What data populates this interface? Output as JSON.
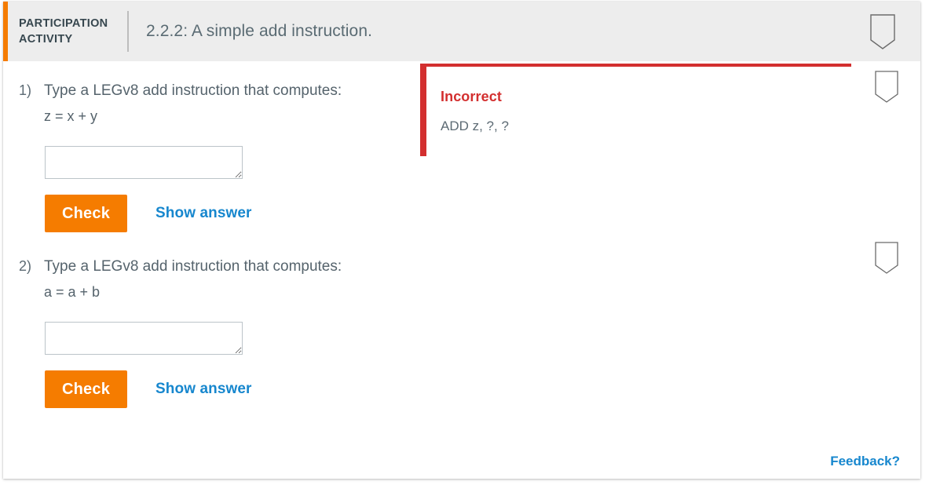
{
  "header": {
    "label_line1": "PARTICIPATION",
    "label_line2": "ACTIVITY",
    "title": "2.2.2: A simple add instruction.",
    "bookmark_icon": "bookmark-icon",
    "accent_color": "#f57c00",
    "background": "#ededed"
  },
  "questions": [
    {
      "number": "1)",
      "prompt": "Type a LEGv8 add instruction that computes:",
      "expression": "z = x + y",
      "answer_value": "",
      "answer_placeholder": "",
      "check_label": "Check",
      "show_answer_label": "Show answer",
      "bookmark_icon": "bookmark-icon"
    },
    {
      "number": "2)",
      "prompt": "Type a LEGv8 add instruction that computes:",
      "expression": "a = a + b",
      "answer_value": "",
      "answer_placeholder": "",
      "check_label": "Check",
      "show_answer_label": "Show answer",
      "bookmark_icon": "bookmark-icon"
    }
  ],
  "feedback_panel": {
    "status": "Incorrect",
    "detail": "ADD z, ?, ?",
    "accent_color": "#d32f2f"
  },
  "footer": {
    "feedback_label": "Feedback?",
    "link_color": "#1787ce"
  }
}
